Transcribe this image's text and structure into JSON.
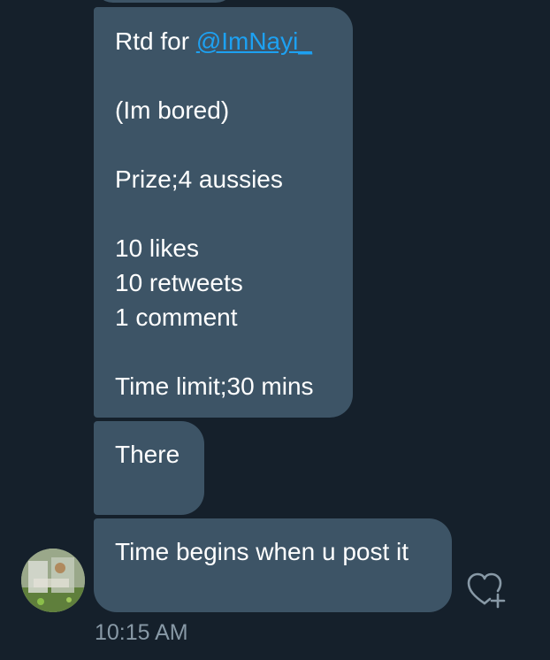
{
  "messages": [
    {
      "lines": [
        "Rtd for ",
        "",
        "(Im bored)",
        "",
        "Prize;4 aussies",
        "",
        "10 likes",
        "10 retweets",
        "1 comment",
        "",
        "Time limit;30 mins"
      ],
      "mention": "@ImNayi_"
    },
    {
      "text": "There"
    },
    {
      "text": "Time begins when u post it"
    }
  ],
  "timestamp": "10:15 AM",
  "colors": {
    "background": "#15202b",
    "bubble": "#3d5466",
    "mention": "#1da1f2",
    "timestamp": "#8899a6"
  },
  "icons": {
    "like": "heart-plus-icon",
    "avatar": "avatar"
  }
}
